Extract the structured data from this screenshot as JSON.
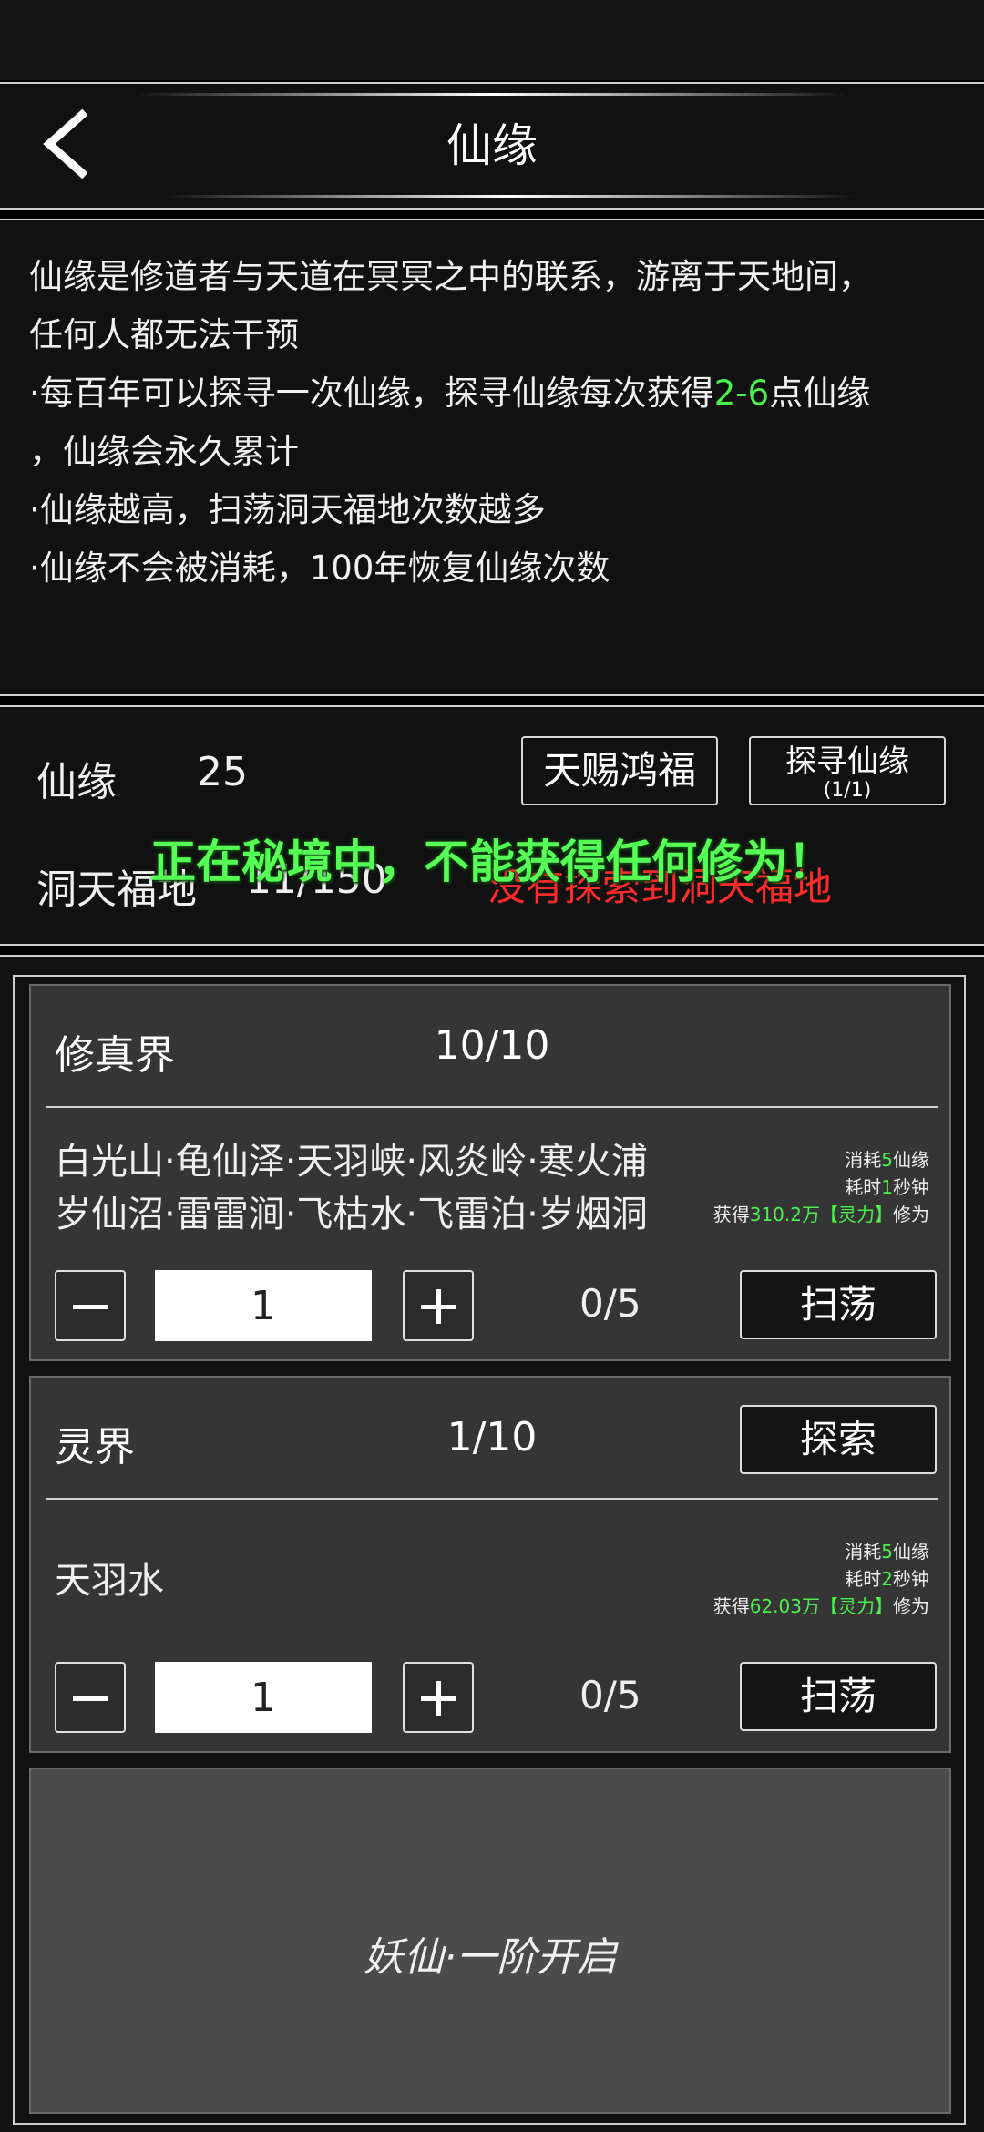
{
  "header": {
    "title": "仙缘"
  },
  "description": {
    "line1": "仙缘是修道者与天道在冥冥之中的联系，游离于天地间，",
    "line2": "任何人都无法干预",
    "line3_pre": "·每百年可以探寻一次仙缘，探寻仙缘每次获得",
    "line3_highlight": "2-6",
    "line3_post": "点仙缘",
    "line4": "，仙缘会永久累计",
    "line5": "·仙缘越高，扫荡洞天福地次数越多",
    "line6": "·仙缘不会被消耗，100年恢复仙缘次数"
  },
  "stats": {
    "xianyuan_label": "仙缘",
    "xianyuan_value": "25",
    "dongtian_label": "洞天福地",
    "dongtian_value": "11/150",
    "gift_button": "天赐鸿福",
    "seek_button": "探寻仙缘",
    "seek_count": "(1/1)",
    "warning": "没有探索到洞天福地",
    "overlay": "正在秘境中，不能获得任何修为！"
  },
  "realms": [
    {
      "name": "修真界",
      "count": "10/10",
      "locations_line1": "白光山·龟仙泽·天羽峡·风炎岭·寒火浦",
      "locations_line2": "岁仙沼·雷雷涧·飞枯水·飞雷泊·岁烟洞",
      "cost_pre": "消耗",
      "cost_num": "5",
      "cost_post": "仙缘",
      "time_pre": "耗时",
      "time_num": "1",
      "time_post": "秒钟",
      "gain_pre": "获得",
      "gain_num": "310.2万【灵力】",
      "gain_post": "修为",
      "quantity": "1",
      "progress": "0/5",
      "action": "扫荡"
    },
    {
      "name": "灵界",
      "count": "1/10",
      "explore_button": "探索",
      "locations_line1": "天羽水",
      "cost_pre": "消耗",
      "cost_num": "5",
      "cost_post": "仙缘",
      "time_pre": "耗时",
      "time_num": "2",
      "time_post": "秒钟",
      "gain_pre": "获得",
      "gain_num": "62.03万【灵力】",
      "gain_post": "修为",
      "quantity": "1",
      "progress": "0/5",
      "action": "扫荡"
    }
  ],
  "locked": {
    "text": "妖仙·一阶开启"
  },
  "colors": {
    "highlight_green": "#4cf04c",
    "warning_red": "#ff2a2a",
    "overlay_green": "#55ff55"
  }
}
